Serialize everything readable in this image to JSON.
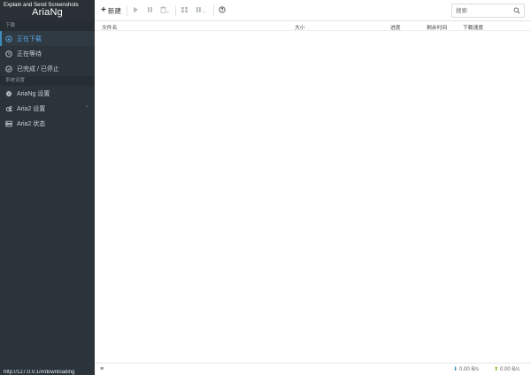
{
  "window": {
    "caption": "Explain and Send Screenshots"
  },
  "sidebar": {
    "brand": "AriaNg",
    "sections": [
      {
        "title": "下载",
        "items": [
          {
            "label": "正在下载",
            "icon": "download-circle-icon",
            "active": true
          },
          {
            "label": "正在等待",
            "icon": "clock-icon",
            "active": false
          },
          {
            "label": "已完成 / 已停止",
            "icon": "check-circle-icon",
            "active": false
          }
        ]
      },
      {
        "title": "系统设置",
        "items": [
          {
            "label": "AriaNg 设置",
            "icon": "gear-icon"
          },
          {
            "label": "Aria2 设置",
            "icon": "gears-icon",
            "chevron": "‹"
          },
          {
            "label": "Aria2 状态",
            "icon": "server-icon"
          }
        ]
      }
    ],
    "footer": "http://127.0.0.1/#/downloading"
  },
  "toolbar": {
    "new_label": "新建",
    "search_placeholder": "搜索"
  },
  "table": {
    "columns": [
      "文件名",
      "大小",
      "进度",
      "剩余时间",
      "下载速度"
    ]
  },
  "statusbar": {
    "download_speed": "0.00 B/s",
    "upload_speed": "0.00 B/s",
    "colors": {
      "download": "#3c8dbc",
      "upload": "#74b816"
    }
  }
}
